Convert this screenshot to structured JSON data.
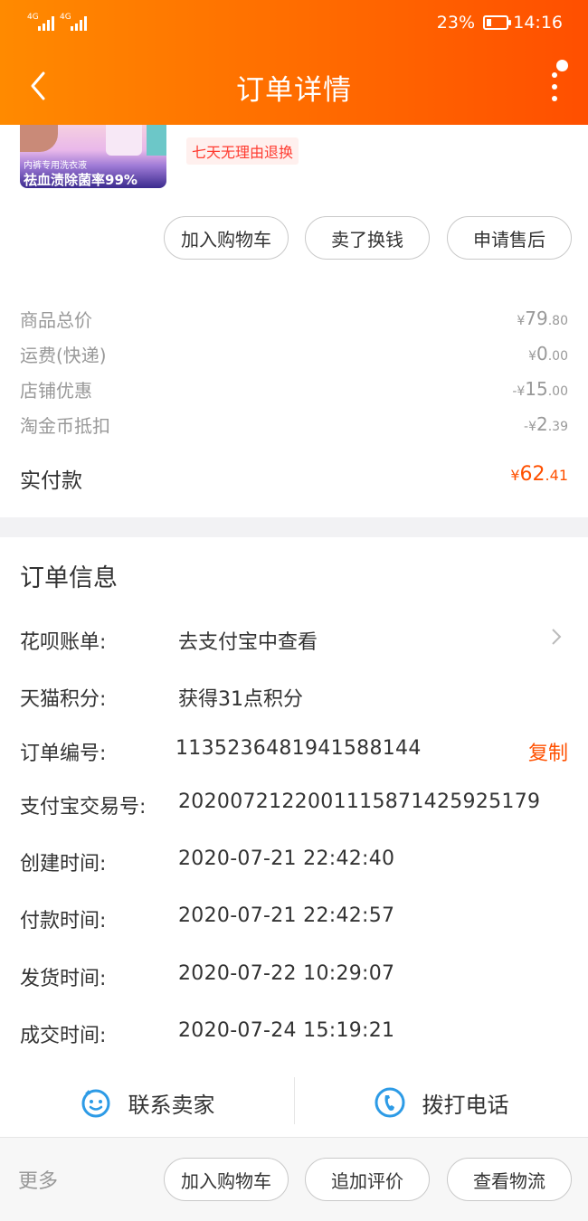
{
  "status_bar": {
    "signal_1": "4G",
    "signal_2": "4G",
    "battery": "23%",
    "time": "14:16"
  },
  "header": {
    "title": "订单详情"
  },
  "product": {
    "image_text_1": "内裤专用洗衣液",
    "image_text_2": "祛血渍除菌率99%",
    "badge": "七天无理由退换"
  },
  "item_actions": [
    "加入购物车",
    "卖了换钱",
    "申请售后"
  ],
  "prices": [
    {
      "label": "商品总价",
      "prefix": "¥",
      "int": "79",
      "dec": ".80"
    },
    {
      "label": "运费(快递)",
      "prefix": "¥",
      "int": "0",
      "dec": ".00"
    },
    {
      "label": "店铺优惠",
      "prefix": "-¥",
      "int": "15",
      "dec": ".00"
    },
    {
      "label": "淘金币抵扣",
      "prefix": "-¥",
      "int": "2",
      "dec": ".39"
    }
  ],
  "paid": {
    "label": "实付款",
    "prefix": "¥",
    "int": "62",
    "dec": ".41"
  },
  "order_info": {
    "title": "订单信息",
    "rows": [
      {
        "key": "花呗账单:",
        "value": "去支付宝中查看"
      },
      {
        "key": "天猫积分:",
        "value": "获得31点积分"
      },
      {
        "key": "订单编号:",
        "value": "1135236481941588144"
      },
      {
        "key": "支付宝交易号:",
        "value": "2020072122001115871425925179"
      },
      {
        "key": "创建时间:",
        "value": "2020-07-21 22:42:40"
      },
      {
        "key": "付款时间:",
        "value": "2020-07-21 22:42:57"
      },
      {
        "key": "发货时间:",
        "value": "2020-07-22 10:29:07"
      },
      {
        "key": "成交时间:",
        "value": "2020-07-24 15:19:21"
      }
    ],
    "copy_label": "复制"
  },
  "contact": {
    "seller": "联系卖家",
    "phone": "拨打电话"
  },
  "bottom": {
    "more": "更多",
    "actions": [
      "加入购物车",
      "追加评价",
      "查看物流"
    ]
  },
  "colors": {
    "accent": "#ff5000",
    "header_start": "#ff8a00",
    "header_end": "#ff4f00",
    "icon_blue": "#2d9be6"
  }
}
